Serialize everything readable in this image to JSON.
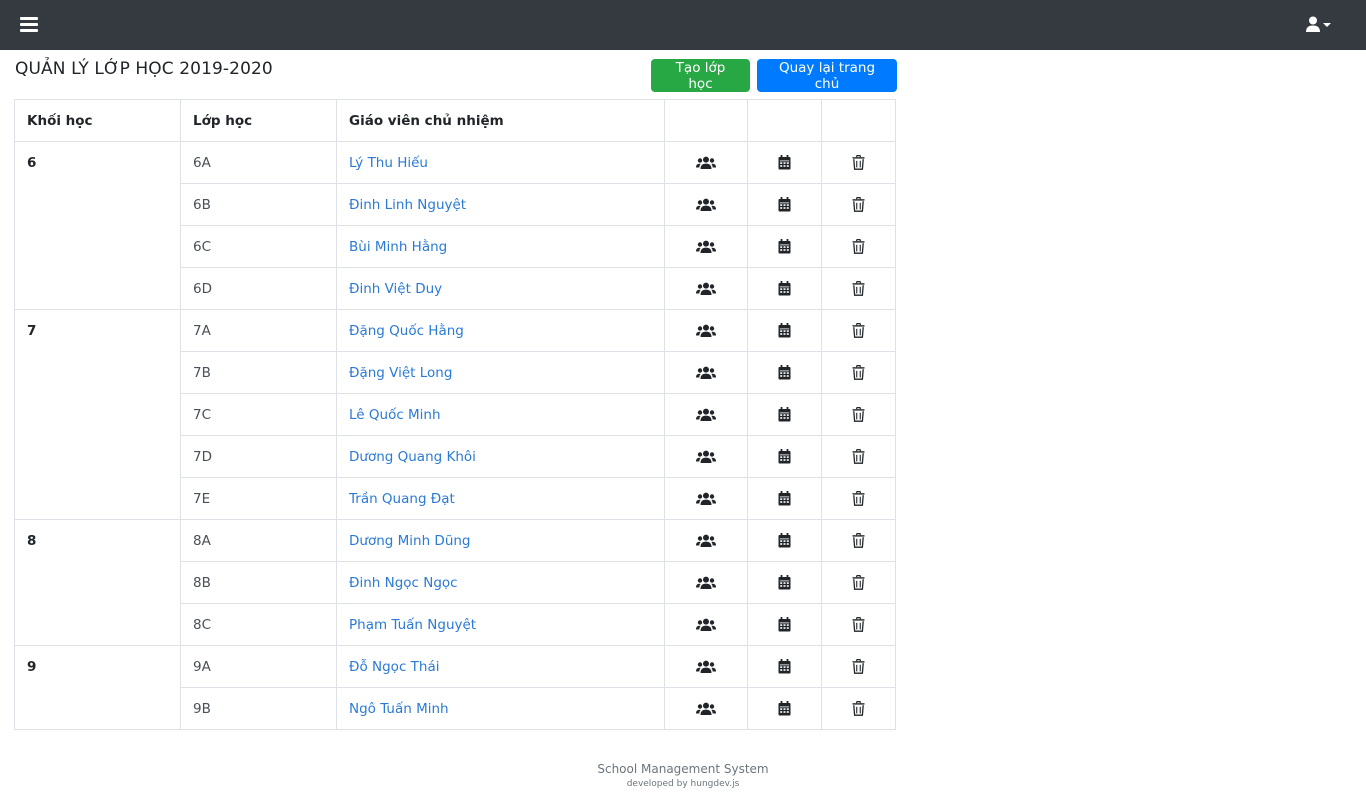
{
  "navbar": {
    "menu_icon": "bars-icon",
    "user_icon": "user-icon"
  },
  "page": {
    "title": "QUẢN LÝ LỚP HỌC 2019-2020",
    "create_button": "Tạo lớp học",
    "home_button": "Quay lại trang chủ"
  },
  "table": {
    "headers": [
      "Khối học",
      "Lớp học",
      "Giáo viên chủ nhiệm"
    ],
    "action_icons": [
      "users-icon",
      "calendar-icon",
      "trash-icon"
    ],
    "groups": [
      {
        "grade": "6",
        "rows": [
          {
            "class": "6A",
            "teacher": "Lý Thu Hiếu"
          },
          {
            "class": "6B",
            "teacher": "Đinh Linh Nguyệt"
          },
          {
            "class": "6C",
            "teacher": "Bùi Minh Hằng"
          },
          {
            "class": "6D",
            "teacher": "Đinh Việt Duy"
          }
        ]
      },
      {
        "grade": "7",
        "rows": [
          {
            "class": "7A",
            "teacher": "Đặng Quốc Hằng"
          },
          {
            "class": "7B",
            "teacher": "Đặng Việt Long"
          },
          {
            "class": "7C",
            "teacher": "Lê Quốc Minh"
          },
          {
            "class": "7D",
            "teacher": "Dương Quang Khôi"
          },
          {
            "class": "7E",
            "teacher": "Trần Quang Đạt"
          }
        ]
      },
      {
        "grade": "8",
        "rows": [
          {
            "class": "8A",
            "teacher": "Dương Minh Dũng"
          },
          {
            "class": "8B",
            "teacher": "Đinh Ngọc Ngọc"
          },
          {
            "class": "8C",
            "teacher": "Phạm Tuấn Nguyệt"
          }
        ]
      },
      {
        "grade": "9",
        "rows": [
          {
            "class": "9A",
            "teacher": "Đỗ Ngọc Thái"
          },
          {
            "class": "9B",
            "teacher": "Ngô Tuấn Minh"
          }
        ]
      }
    ]
  },
  "footer": {
    "name": "School Management System",
    "developer": "developed by hungdev.js"
  }
}
